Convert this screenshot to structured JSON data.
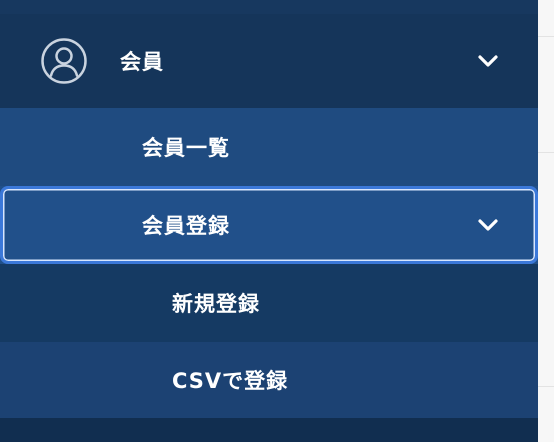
{
  "colors": {
    "sidebar_dark": "#15355a",
    "sidebar_mid": "#1f4b80",
    "selected_bg": "#21508a",
    "focus_border": "#3b78d9",
    "text": "#ffffff"
  },
  "sidebar": {
    "members": {
      "icon": "user-circle-icon",
      "label": "会員",
      "expand_icon": "chevron-down-icon",
      "items": [
        {
          "label": "会員一覧"
        },
        {
          "label": "会員登録",
          "expand_icon": "chevron-down-icon",
          "focused": true,
          "subitems": [
            {
              "label": "新規登録"
            },
            {
              "label": "CSVで登録"
            }
          ]
        }
      ]
    }
  }
}
